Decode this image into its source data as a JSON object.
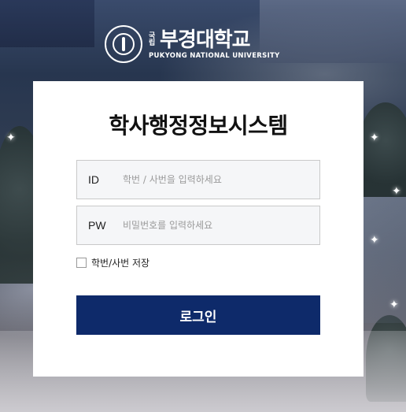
{
  "logo": {
    "gukrip": "국립",
    "name": "부경대학교",
    "name_en": "PUKYONG NATIONAL UNIVERSITY",
    "emblem_text": "PUKYONG NATIONAL UNIVERSITY"
  },
  "title": "학사행정정보시스템",
  "id_field": {
    "label": "ID",
    "placeholder": "학번 / 사번을 입력하세요",
    "value": ""
  },
  "pw_field": {
    "label": "PW",
    "placeholder": "비밀번호를 입력하세요",
    "value": ""
  },
  "remember": {
    "label": "학번/사번 저장",
    "checked": false
  },
  "login_button": {
    "label": "로그인"
  },
  "colors": {
    "primary": "#0e2a6a",
    "field_bg": "#f5f6f8",
    "field_border": "#c9c9c9"
  }
}
